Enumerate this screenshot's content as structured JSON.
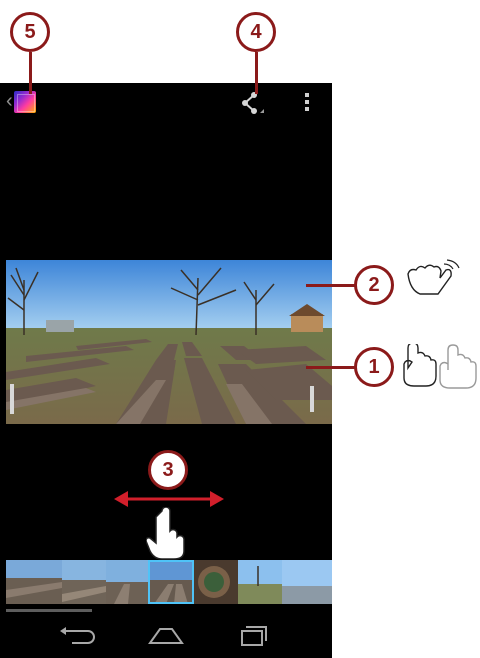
{
  "callouts": {
    "c1": "1",
    "c2": "2",
    "c3": "3",
    "c4": "4",
    "c5": "5"
  },
  "icons": {
    "app": "gallery-app-icon",
    "share": "share-icon",
    "overflow": "overflow-menu-icon",
    "back": "back-nav-icon",
    "home": "home-nav-icon",
    "recents": "recents-nav-icon"
  },
  "colors": {
    "callout_border": "#8b1a1a",
    "screen_background": "#000000",
    "selection_accent": "#4fc3f7"
  }
}
